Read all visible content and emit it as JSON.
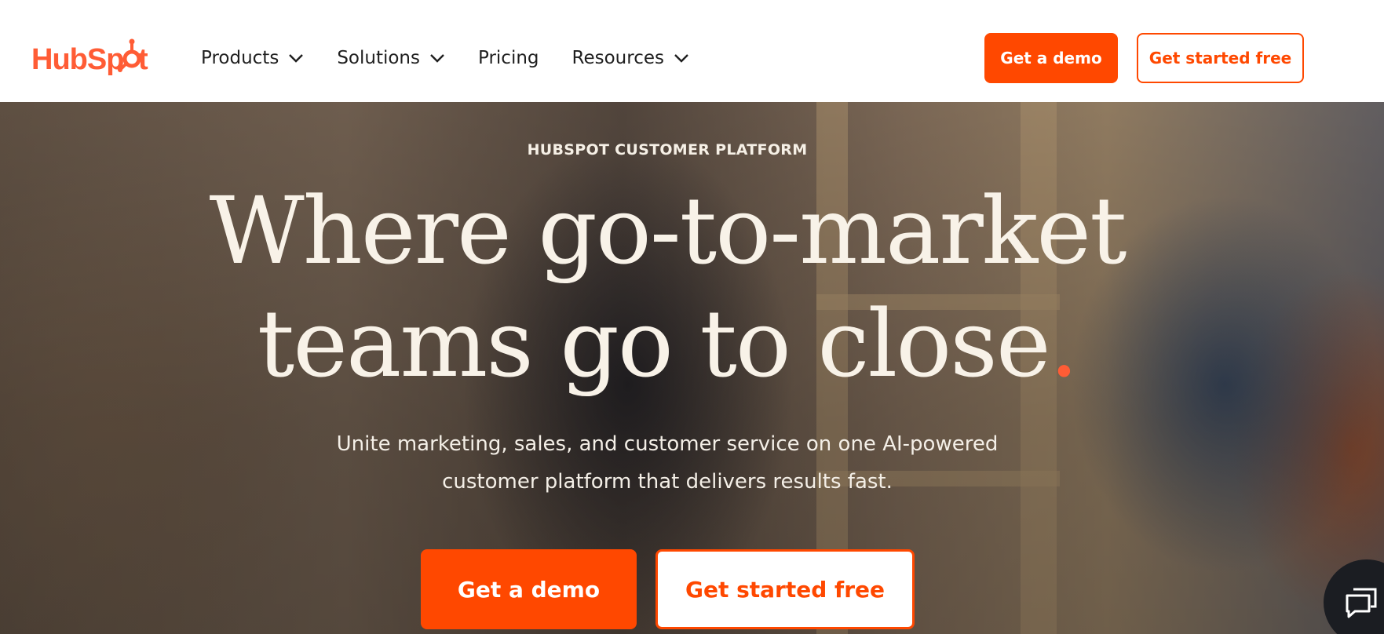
{
  "header": {
    "logo_text": "HubSpot",
    "nav": [
      {
        "label": "Products",
        "has_dropdown": true
      },
      {
        "label": "Solutions",
        "has_dropdown": true
      },
      {
        "label": "Pricing",
        "has_dropdown": false
      },
      {
        "label": "Resources",
        "has_dropdown": true
      }
    ],
    "demo_button": "Get a demo",
    "free_button": "Get started free"
  },
  "hero": {
    "eyebrow": "HUBSPOT CUSTOMER PLATFORM",
    "headline_line1": "Where go-to-market",
    "headline_line2": "teams go to close",
    "headline_dot": ".",
    "subhead_line1": "Unite marketing, sales, and customer service on one AI-powered",
    "subhead_line2": "customer platform that delivers results fast.",
    "demo_button": "Get a demo",
    "free_button": "Get started free"
  },
  "chat": {
    "icon": "chat-icon"
  },
  "colors": {
    "brand_orange": "#ff4800",
    "logo_orange": "#ff5c35",
    "text_dark": "#1f1f1f",
    "hero_text": "#f8f2e8"
  }
}
